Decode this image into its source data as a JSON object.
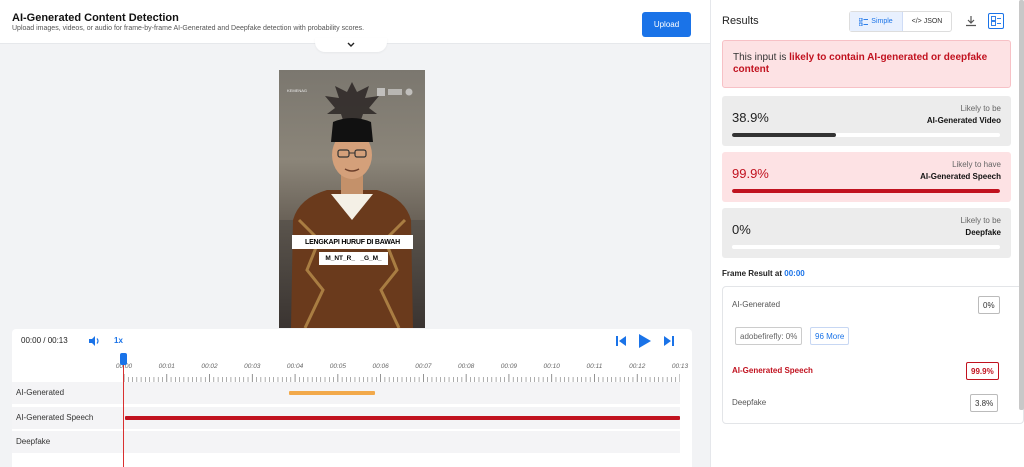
{
  "header": {
    "title": "AI-Generated Content Detection",
    "subtitle": "Upload images, videos, or audio for frame-by-frame AI-Generated and Deepfake detection with probability scores.",
    "upload_label": "Upload"
  },
  "video": {
    "logo_left": "KEMENAG",
    "caption_line1": "LENGKAPI HURUF DI BAWAH",
    "caption_line2": "M_NT_R_   _G_M_"
  },
  "player": {
    "time": "00:00 / 00:13",
    "speed": "1x",
    "ticks": [
      "00:00",
      "00:01",
      "00:02",
      "00:03",
      "00:04",
      "00:05",
      "00:06",
      "00:07",
      "00:08",
      "00:09",
      "00:10",
      "00:11",
      "00:12",
      "00:13"
    ],
    "tracks": [
      {
        "label": "AI-Generated",
        "segments": [
          {
            "start": 4.0,
            "end": 6.0,
            "color": "#f2a94b"
          }
        ]
      },
      {
        "label": "AI-Generated Speech",
        "segments": [
          {
            "start": 0.0,
            "end": 13.0,
            "color": "#c1121f"
          }
        ]
      },
      {
        "label": "Deepfake",
        "segments": []
      }
    ],
    "duration": 13,
    "current": 0
  },
  "results": {
    "title": "Results",
    "toggle_simple": "Simple",
    "toggle_json": "</> JSON",
    "alert_prefix": "This input is ",
    "alert_highlight": "likely to contain AI-generated or deepfake content",
    "cards": [
      {
        "pct": "38.9%",
        "line1": "Likely to be",
        "line2": "AI-Generated Video",
        "value": 0.389,
        "bg": "#ececec",
        "fill": "#333333",
        "pct_color": "#222222"
      },
      {
        "pct": "99.9%",
        "line1": "Likely to have",
        "line2": "AI-Generated Speech",
        "value": 0.999,
        "bg": "#fde2e4",
        "fill": "#c1121f",
        "pct_color": "#c1121f"
      },
      {
        "pct": "0%",
        "line1": "Likely to be",
        "line2": "Deepfake",
        "value": 0.0,
        "bg": "#ececec",
        "fill": "#333333",
        "pct_color": "#222222"
      }
    ],
    "frame_result_label": "Frame Result at ",
    "frame_result_time": "00:00",
    "frame_rows": {
      "ai_generated": {
        "label": "AI-Generated",
        "value": "0%"
      },
      "chip_adobe": "adobefirefly: 0%",
      "chip_more": "96 More",
      "ai_speech": {
        "label": "AI-Generated Speech",
        "value": "99.9%"
      },
      "deepfake": {
        "label": "Deepfake",
        "value": "3.8%"
      }
    }
  }
}
